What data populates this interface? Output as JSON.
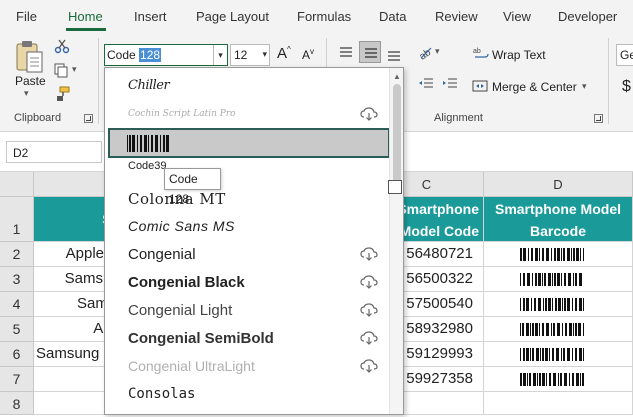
{
  "tabs": [
    {
      "label": "File"
    },
    {
      "label": "Home",
      "active": true
    },
    {
      "label": "Insert"
    },
    {
      "label": "Page Layout"
    },
    {
      "label": "Formulas"
    },
    {
      "label": "Data"
    },
    {
      "label": "Review"
    },
    {
      "label": "View"
    },
    {
      "label": "Developer"
    }
  ],
  "ribbon": {
    "paste_label": "Paste",
    "clipboard_label": "Clipboard",
    "font_name_typed": "Code ",
    "font_name_selected": "128",
    "font_size": "12",
    "wrap_text_label": "Wrap Text",
    "merge_center_label": "Merge & Center",
    "alignment_label": "Alignment",
    "number_format_partial": "Ge",
    "currency_symbol": "$"
  },
  "name_box": "D2",
  "columns": [
    "C",
    "D"
  ],
  "rows": [
    "1",
    "2",
    "3",
    "4",
    "5",
    "6",
    "7",
    "8"
  ],
  "sheet": {
    "col_a_header_partial": "Sm",
    "col_c_header": "Smartphone Model Code",
    "col_d_header": "Smartphone Model Barcode",
    "col_a_values": [
      "Apple",
      "Samsung",
      "Samsun",
      "App",
      "Samsung",
      ""
    ],
    "col_c_values": [
      "56480721",
      "56500322",
      "57500540",
      "58932980",
      "59129993",
      "59927358"
    ]
  },
  "font_dropdown": {
    "items": [
      {
        "name": "Chiller",
        "cloud": false
      },
      {
        "name": "Cochin Script Latin Pro",
        "cloud": true
      },
      {
        "name": "Code 128",
        "cloud": false,
        "selected": true,
        "barcode_preview": true
      },
      {
        "name": "Code39",
        "cloud": false
      },
      {
        "name": "Colonna MT",
        "cloud": false
      },
      {
        "name": "Comic Sans MS",
        "cloud": false
      },
      {
        "name": "Congenial",
        "cloud": true
      },
      {
        "name": "Congenial Black",
        "cloud": true
      },
      {
        "name": "Congenial Light",
        "cloud": true
      },
      {
        "name": "Congenial SemiBold",
        "cloud": true
      },
      {
        "name": "Congenial UltraLight",
        "cloud": true
      },
      {
        "name": "Consolas",
        "cloud": false
      }
    ],
    "tooltip": "Code 128"
  },
  "colors": {
    "accent": "#1a6b3c",
    "table_header": "#1a9b9a",
    "selected_border": "#2b5d56"
  }
}
